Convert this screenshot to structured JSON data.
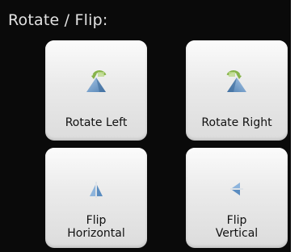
{
  "panel": {
    "title": "Rotate / Flip:"
  },
  "buttons": [
    {
      "label": "Rotate Left",
      "icon": "rotate-left-icon"
    },
    {
      "label": "Rotate Right",
      "icon": "rotate-right-icon"
    },
    {
      "label": "Flip\nHorizontal",
      "icon": "flip-horizontal-icon"
    },
    {
      "label": "Flip\nVertical",
      "icon": "flip-vertical-icon"
    }
  ],
  "colors": {
    "background": "#0a0a0a",
    "title": "#e2e2e2",
    "tile": "#eaeaea",
    "icon_blue": "#5f8fc0",
    "icon_green": "#8fb84a"
  }
}
